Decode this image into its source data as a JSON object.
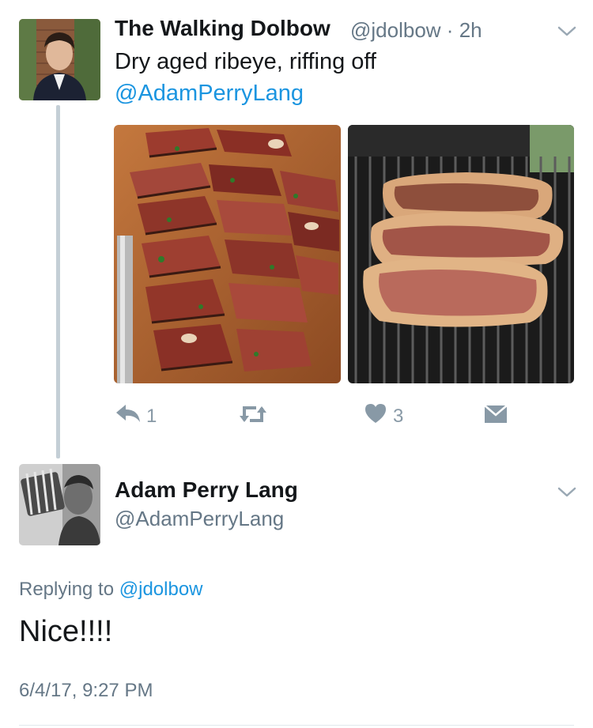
{
  "tweet": {
    "author_name": "The Walking Dolbow",
    "author_handle": "@jdolbow",
    "separator": "·",
    "age": "2h",
    "text": "Dry aged ribeye, riffing off",
    "mention": "@AdamPerryLang",
    "actions": {
      "reply_count": "1",
      "retweet_count": "",
      "like_count": "3"
    },
    "media": [
      "sliced-ribeye-photo",
      "ribeye-on-grill-photo"
    ]
  },
  "reply": {
    "author_name": "Adam Perry Lang",
    "author_handle": "@AdamPerryLang",
    "replying_label": "Replying to",
    "replying_to": "@jdolbow",
    "text": "Nice!!!!",
    "timestamp": "6/4/17, 9:27 PM"
  },
  "colors": {
    "link": "#1b95e0",
    "secondary_text": "#657786",
    "icon": "#8899a6",
    "thread_line": "#c4cfd6"
  },
  "icons": [
    "chevron-down-icon",
    "reply-icon",
    "retweet-icon",
    "like-icon",
    "direct-message-icon"
  ]
}
